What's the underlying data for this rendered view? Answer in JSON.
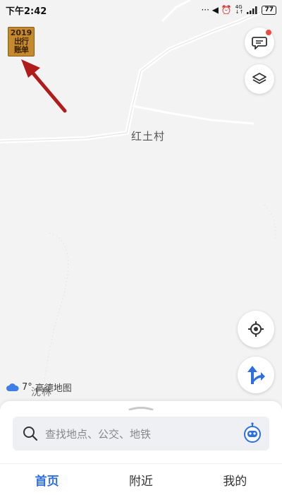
{
  "status_bar": {
    "time": "下午2:42",
    "network_icons": "··· ◀ ⏰",
    "signal_top": "4G",
    "signal_bottom": "↓↑",
    "battery": "77"
  },
  "map": {
    "promo_badge": {
      "year": "2019",
      "line1": "出行",
      "line2": "账单"
    },
    "place_labels": {
      "village": "红土村",
      "town": "沈林"
    },
    "weather": {
      "temperature": "7°",
      "provider": "高德地图"
    }
  },
  "search": {
    "placeholder": "查找地点、公交、地铁"
  },
  "tabs": [
    {
      "label": "首页",
      "active": true
    },
    {
      "label": "附近",
      "active": false
    },
    {
      "label": "我的",
      "active": false
    }
  ],
  "colors": {
    "accent": "#2e6fe0",
    "badge": "#c58a2d",
    "arrow": "#b01c1c",
    "notify": "#f24a3c"
  }
}
